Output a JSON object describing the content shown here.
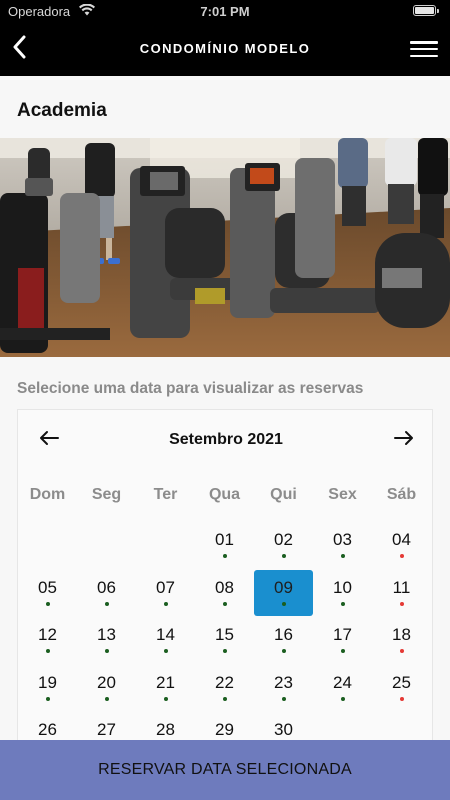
{
  "status_bar": {
    "carrier": "Operadora",
    "time": "7:01 PM"
  },
  "header": {
    "title": "CONDOMÍNIO MODELO",
    "back_icon": "chevron-left-icon",
    "menu_icon": "hamburger-menu-icon"
  },
  "page": {
    "title": "Academia"
  },
  "photo": {
    "description_icon": "gym-photo"
  },
  "calendar": {
    "hint": "Selecione uma data para visualizar as reservas",
    "month": "Setembro 2021",
    "weekdays": [
      "Dom",
      "Seg",
      "Ter",
      "Qua",
      "Qui",
      "Sex",
      "Sáb"
    ],
    "selected_day": "09",
    "selected_color": "#1a8fcf",
    "dot_colors": {
      "available": "#1b5e20",
      "weekend": "#e53935"
    },
    "days": [
      {
        "label": "",
        "dot": ""
      },
      {
        "label": "",
        "dot": ""
      },
      {
        "label": "",
        "dot": ""
      },
      {
        "label": "01",
        "dot": "available"
      },
      {
        "label": "02",
        "dot": "available"
      },
      {
        "label": "03",
        "dot": "available"
      },
      {
        "label": "04",
        "dot": "weekend"
      },
      {
        "label": "05",
        "dot": "available"
      },
      {
        "label": "06",
        "dot": "available"
      },
      {
        "label": "07",
        "dot": "available"
      },
      {
        "label": "08",
        "dot": "available"
      },
      {
        "label": "09",
        "dot": "available"
      },
      {
        "label": "10",
        "dot": "available"
      },
      {
        "label": "11",
        "dot": "weekend"
      },
      {
        "label": "12",
        "dot": "available"
      },
      {
        "label": "13",
        "dot": "available"
      },
      {
        "label": "14",
        "dot": "available"
      },
      {
        "label": "15",
        "dot": "available"
      },
      {
        "label": "16",
        "dot": "available"
      },
      {
        "label": "17",
        "dot": "available"
      },
      {
        "label": "18",
        "dot": "weekend"
      },
      {
        "label": "19",
        "dot": "available"
      },
      {
        "label": "20",
        "dot": "available"
      },
      {
        "label": "21",
        "dot": "available"
      },
      {
        "label": "22",
        "dot": "available"
      },
      {
        "label": "23",
        "dot": "available"
      },
      {
        "label": "24",
        "dot": "available"
      },
      {
        "label": "25",
        "dot": "weekend"
      },
      {
        "label": "26",
        "dot": "available"
      },
      {
        "label": "27",
        "dot": "available"
      },
      {
        "label": "28",
        "dot": "available"
      },
      {
        "label": "29",
        "dot": "available"
      },
      {
        "label": "30",
        "dot": "available"
      }
    ]
  },
  "footer": {
    "button_label": "RESERVAR DATA SELECIONADA",
    "button_color": "#6e7bbd"
  }
}
